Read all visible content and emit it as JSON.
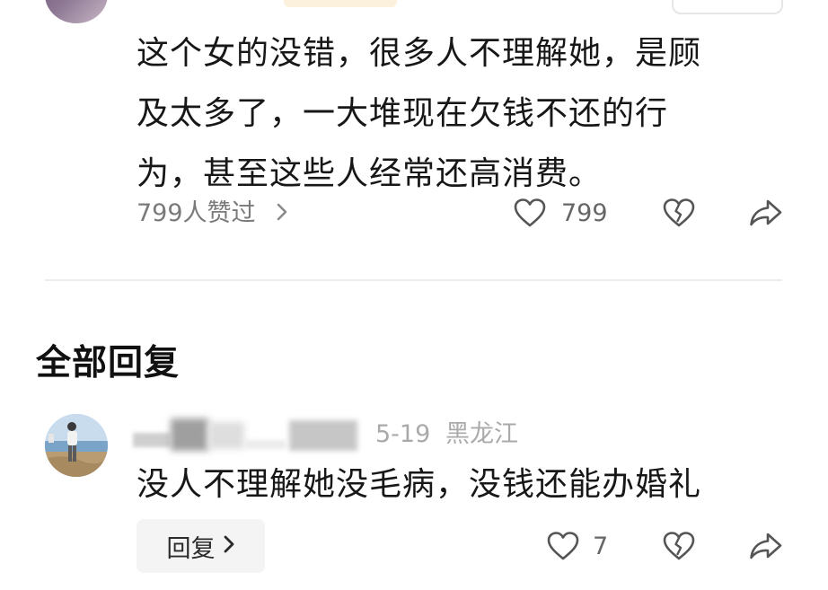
{
  "post": {
    "body": "这个女的没错，很多人不理解她，是顾\n及太多了，一大堆现在欠钱不还的行\n为，甚至这些人经常还高消费。",
    "likers_text": "799人赞过",
    "like_count": "799"
  },
  "section_title": "全部回复",
  "reply": {
    "date": "5-19",
    "location": "黑龙江",
    "text": "没人不理解她没毛病，没钱还能办婚礼",
    "reply_label": "回复",
    "like_count": "7"
  },
  "colors": {
    "text": "#171717",
    "muted": "#7a7a7a",
    "icon": "#555555",
    "divider": "#ececec",
    "reply_button_bg": "#f4f4f4"
  },
  "icons": [
    "heart-outline-icon",
    "broken-heart-icon",
    "share-arrow-icon",
    "chevron-right-icon"
  ]
}
